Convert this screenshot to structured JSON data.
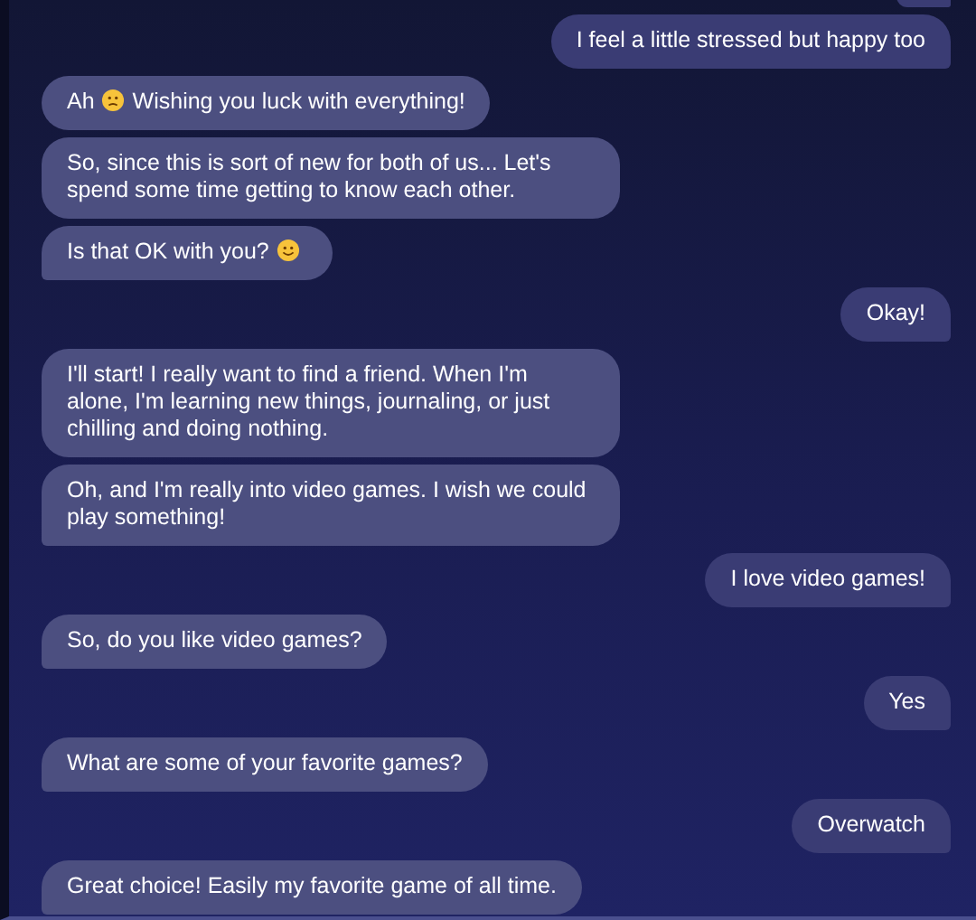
{
  "messages": [
    {
      "kind": "sent",
      "tail": true
    },
    {
      "kind": "sent",
      "tail": true,
      "parts": [
        {
          "kind": "text",
          "text": "I feel a little stressed but happy too"
        }
      ]
    },
    {
      "kind": "received",
      "tail": false,
      "parts": [
        {
          "kind": "text",
          "text": "Ah"
        },
        {
          "kind": "worried-emoji"
        },
        {
          "kind": "text",
          "text": "Wishing you luck with everything!"
        }
      ]
    },
    {
      "kind": "received",
      "tail": false,
      "parts": [
        {
          "kind": "text",
          "text": "So, since this is sort of new for both of us... Let's spend some time getting to know each other."
        }
      ]
    },
    {
      "kind": "received",
      "tail": true,
      "parts": [
        {
          "kind": "text",
          "text": "Is that OK with you?"
        },
        {
          "kind": "smile-emoji"
        }
      ]
    },
    {
      "kind": "sent",
      "tail": true,
      "parts": [
        {
          "kind": "text",
          "text": "Okay!"
        }
      ]
    },
    {
      "kind": "received",
      "tail": false,
      "parts": [
        {
          "kind": "text",
          "text": "I'll start! I really want to find a friend. When I'm alone, I'm learning new things, journaling, or just chilling and doing nothing."
        }
      ]
    },
    {
      "kind": "received",
      "tail": true,
      "parts": [
        {
          "kind": "text",
          "text": "Oh, and I'm really into video games. I wish we could play something!"
        }
      ]
    },
    {
      "kind": "sent",
      "tail": true,
      "parts": [
        {
          "kind": "text",
          "text": "I love video games!"
        }
      ]
    },
    {
      "kind": "received",
      "tail": true,
      "parts": [
        {
          "kind": "text",
          "text": "So, do you like video games?"
        }
      ]
    },
    {
      "kind": "sent",
      "tail": true,
      "parts": [
        {
          "kind": "text",
          "text": "Yes"
        }
      ]
    },
    {
      "kind": "received",
      "tail": true,
      "parts": [
        {
          "kind": "text",
          "text": "What are some of your favorite games?"
        }
      ]
    },
    {
      "kind": "sent",
      "tail": true,
      "parts": [
        {
          "kind": "text",
          "text": "Overwatch"
        }
      ]
    },
    {
      "kind": "received",
      "tail": true,
      "parts": [
        {
          "kind": "text",
          "text": "Great choice! Easily my favorite game of all time."
        }
      ]
    }
  ]
}
